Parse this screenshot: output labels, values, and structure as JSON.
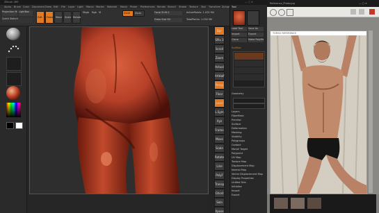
{
  "zbrush": {
    "title": "ZBrush 4R5",
    "menu": [
      "Alpha",
      "Brush",
      "Color",
      "Document",
      "Draw",
      "Edit",
      "File",
      "Layer",
      "Light",
      "Macro",
      "Marker",
      "Material",
      "Movie",
      "Picker",
      "Preferences",
      "Render",
      "Stencil",
      "Stroke",
      "Texture",
      "Tool",
      "Transform",
      "Zplugin",
      "Zscript"
    ],
    "shelf": {
      "projection_label": "Projection Master",
      "lightbox_label": "LightBox",
      "quick_sketch_label": "Quick Sketch",
      "edit_label": "Edit",
      "draw_label": "Draw",
      "move_label": "Move",
      "scale_label": "Scale",
      "rotate_label": "Rotate",
      "mrgb_label": "Mrgb",
      "rgb_label": "Rgb",
      "m_label": "M",
      "zadd_label": "Zadd",
      "zsub_label": "Zsub",
      "focal_label": "Focal Shift 0",
      "draw_size_label": "Draw Size 64",
      "active_points_label": "ActivePoints: 1.032 Mil",
      "total_points_label": "TotalPoints: 1.032 Mil"
    },
    "right_tray": {
      "header": "Tool",
      "buttons": [
        "Load Tool",
        "Save As",
        "Import",
        "Export",
        "Clone",
        "Make PolyMesh3D",
        "GoZ",
        "All",
        "Visible",
        "R"
      ],
      "subtool_label": "SubTool",
      "rows": [
        "Geometry",
        "Layers",
        "FiberMesh",
        "Preview",
        "Surface",
        "Deformation",
        "Masking",
        "Visibility",
        "Polygroups",
        "Contact",
        "Morph Target",
        "Polypaint",
        "UV Map",
        "Texture Map",
        "Displacement Map",
        "Normal Map",
        "Vector Displacement Map",
        "Display Properties",
        "Unified Skin",
        "Initialize",
        "Import",
        "Export"
      ]
    },
    "right_shelf": [
      "Bpr",
      "SPix 3",
      "Scroll",
      "Zoom",
      "Actual",
      "AAHalf",
      "Persp",
      "Floor",
      "Local",
      "L.Sym",
      "Xyz",
      "Frame",
      "Move",
      "Scale",
      "Rotate",
      "Line Fill",
      "PolyF",
      "Transp",
      "Ghost",
      "Solo",
      "Xpose"
    ]
  },
  "photo_viewer": {
    "title": "Reference_Photo.jpg",
    "header_text": "TORSO REFERENCE"
  },
  "colors": {
    "accent": "#e07a24",
    "sculpt_clay": "#b64028",
    "sculpt_dark": "#4a1009",
    "backdrop": "#cfc9be",
    "skin": "#c08a6b",
    "shorts": "#151515"
  }
}
